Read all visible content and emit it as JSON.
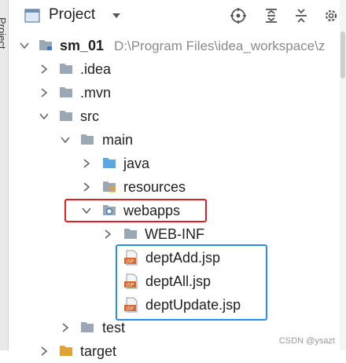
{
  "window": {
    "side_tab": "Project"
  },
  "toolbar": {
    "title": "Project",
    "dropdown_icon": "caret-down-icon",
    "actions": [
      "locate-icon",
      "expand-all-icon",
      "collapse-all-icon",
      "settings-icon"
    ]
  },
  "tree": {
    "project": {
      "name": "sm_01",
      "path": "D:\\Program Files\\idea_workspace\\z"
    },
    "idea": ".idea",
    "mvn": ".mvn",
    "src": "src",
    "main": "main",
    "java": "java",
    "resources": "resources",
    "webapps": "webapps",
    "webinf": "WEB-INF",
    "files": [
      "deptAdd.jsp",
      "deptAll.jsp",
      "deptUpdate.jsp"
    ],
    "test": "test",
    "target": "target"
  },
  "annotations": {
    "red": "#e02020",
    "blue": "#2a8de8"
  },
  "watermark": "CSDN @ysazt"
}
